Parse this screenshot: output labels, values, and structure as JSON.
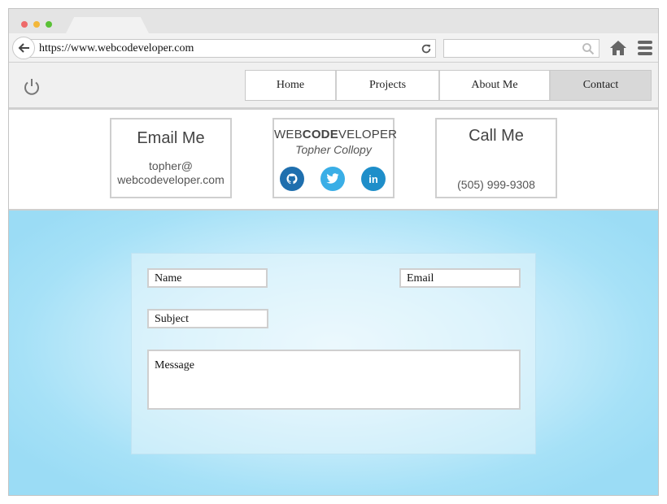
{
  "browser": {
    "url": "https://www.webcodeveloper.com",
    "search_placeholder": ""
  },
  "nav": {
    "items": [
      {
        "label": "Home",
        "active": false
      },
      {
        "label": "Projects",
        "active": false
      },
      {
        "label": "About Me",
        "active": false
      },
      {
        "label": "Contact",
        "active": true
      }
    ]
  },
  "cards": {
    "email": {
      "title": "Email Me",
      "line1": "topher@",
      "line2": "webcodeveloper.com"
    },
    "brand": {
      "logo_prefix": "WEB",
      "logo_bold": "CODE",
      "logo_suffix": "VELOPER",
      "name": "Topher Collopy",
      "socials": [
        "github-icon",
        "twitter-icon",
        "linkedin-icon"
      ]
    },
    "call": {
      "title": "Call Me",
      "phone": "(505) 999-9308"
    }
  },
  "form": {
    "name_placeholder": "Name",
    "email_placeholder": "Email",
    "subject_placeholder": "Subject",
    "message_placeholder": "Message"
  },
  "colors": {
    "active_nav": "#d8d8d8",
    "github": "#1f6fae",
    "twitter": "#3aaee6",
    "linkedin": "#1e8ec9",
    "section_bg": "#9bdcf5"
  }
}
